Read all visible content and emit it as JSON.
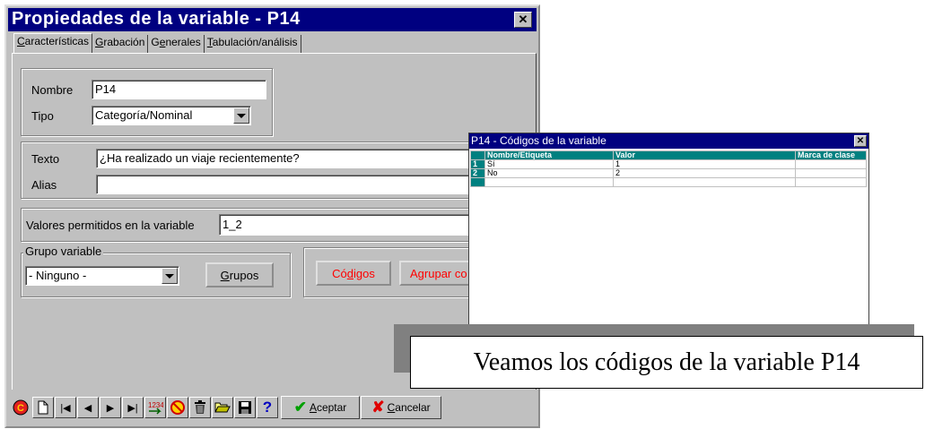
{
  "main_window": {
    "title": "Propiedades de la variable - P14",
    "close_glyph": "✕",
    "tabs": [
      {
        "pre": "",
        "u": "C",
        "post": "aracterísticas",
        "active": true
      },
      {
        "pre": "",
        "u": "G",
        "post": "rabación",
        "active": false
      },
      {
        "pre": "G",
        "u": "e",
        "post": "nerales",
        "active": false
      },
      {
        "pre": "",
        "u": "T",
        "post": "abulación/análisis",
        "active": false
      }
    ],
    "nombre_label": "Nombre",
    "nombre_value": "P14",
    "tipo_label": "Tipo",
    "tipo_value": "Categoría/Nominal",
    "texto_label": "Texto",
    "texto_value": "¿Ha realizado un viaje recientemente?",
    "alias_label": "Alias",
    "alias_value": "",
    "valores_label": "Valores permitidos en la variable",
    "valores_value": "1_2",
    "grupo_label": "Grupo variable",
    "grupo_value": "- Ninguno -",
    "grupos_button": {
      "pre": "",
      "u": "G",
      "post": "rupos"
    },
    "codigos_button": {
      "pre": "Có",
      "u": "d",
      "post": "igos"
    },
    "agrupar_button": "Agrupar co",
    "aceptar_button": {
      "pre": "",
      "u": "A",
      "post": "ceptar"
    },
    "cancelar_button": {
      "pre": "",
      "u": "C",
      "post": "ancelar"
    }
  },
  "codes_window": {
    "title": "P14 - Códigos de la variable",
    "close_glyph": "✕",
    "columns": [
      "",
      "Nombre/Etiqueta",
      "Valor",
      "Marca de clase"
    ],
    "rows": [
      {
        "num": "1",
        "name": "Sí",
        "value": "1",
        "marca": ""
      },
      {
        "num": "2",
        "name": "No",
        "value": "2",
        "marca": ""
      },
      {
        "num": "",
        "name": "",
        "value": "",
        "marca": ""
      }
    ]
  },
  "caption": "Veamos los códigos de la variable P14",
  "colors": {
    "title_bar": "#000080",
    "codes_title_bar": "#000080",
    "grid_header": "#008080",
    "red_text": "#ff0000"
  }
}
